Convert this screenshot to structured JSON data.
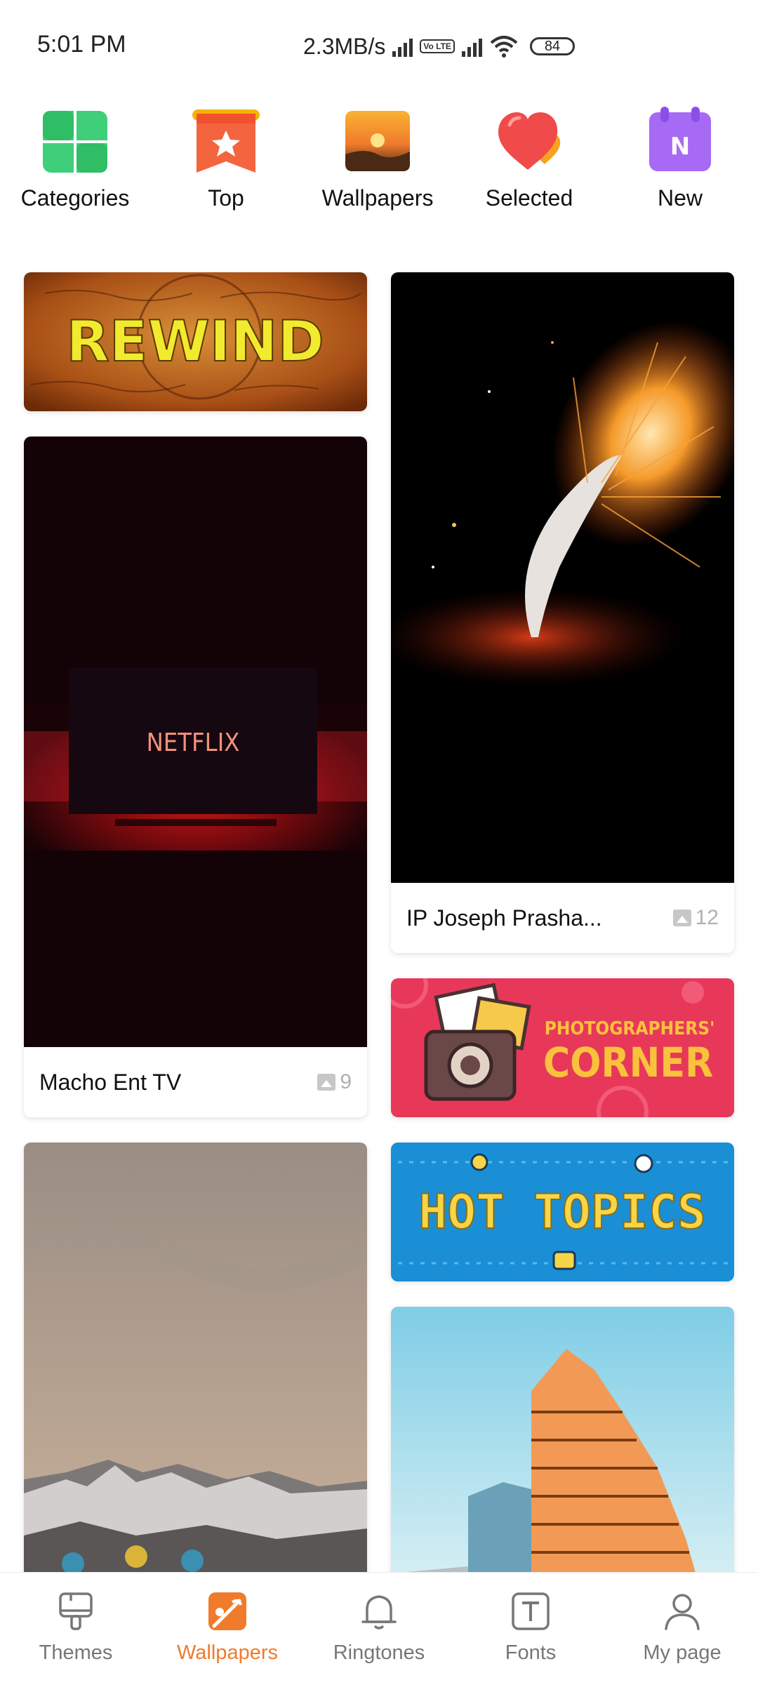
{
  "status_bar": {
    "time": "5:01 PM",
    "network_speed": "2.3MB/s",
    "volte": "Vo LTE",
    "battery": "84"
  },
  "quick_links": [
    {
      "label": "Categories",
      "icon": "categories-grid-icon"
    },
    {
      "label": "Top",
      "icon": "top-ribbon-star-icon"
    },
    {
      "label": "Wallpapers",
      "icon": "sunset-wallpaper-icon"
    },
    {
      "label": "Selected",
      "icon": "heart-icon"
    },
    {
      "label": "New",
      "icon": "new-calendar-icon"
    }
  ],
  "banners": {
    "rewind": "REWIND",
    "photographers_top": "PHOTOGRAPHERS'",
    "photographers_bottom": "CORNER",
    "hot_topics": "HOT TOPICS"
  },
  "cards": [
    {
      "title": "Macho Ent TV",
      "count": "9",
      "image_text": "NETFLIX"
    },
    {
      "title": "IP Joseph Prasha...",
      "count": "12"
    }
  ],
  "bottom_nav": [
    {
      "label": "Themes",
      "icon": "themes-brush-icon",
      "active": false
    },
    {
      "label": "Wallpapers",
      "icon": "wallpapers-icon",
      "active": true
    },
    {
      "label": "Ringtones",
      "icon": "bell-icon",
      "active": false
    },
    {
      "label": "Fonts",
      "icon": "fonts-t-icon",
      "active": false
    },
    {
      "label": "My page",
      "icon": "person-icon",
      "active": false
    }
  ],
  "colors": {
    "accent": "#f07b2c",
    "nav_inactive": "#777777"
  }
}
